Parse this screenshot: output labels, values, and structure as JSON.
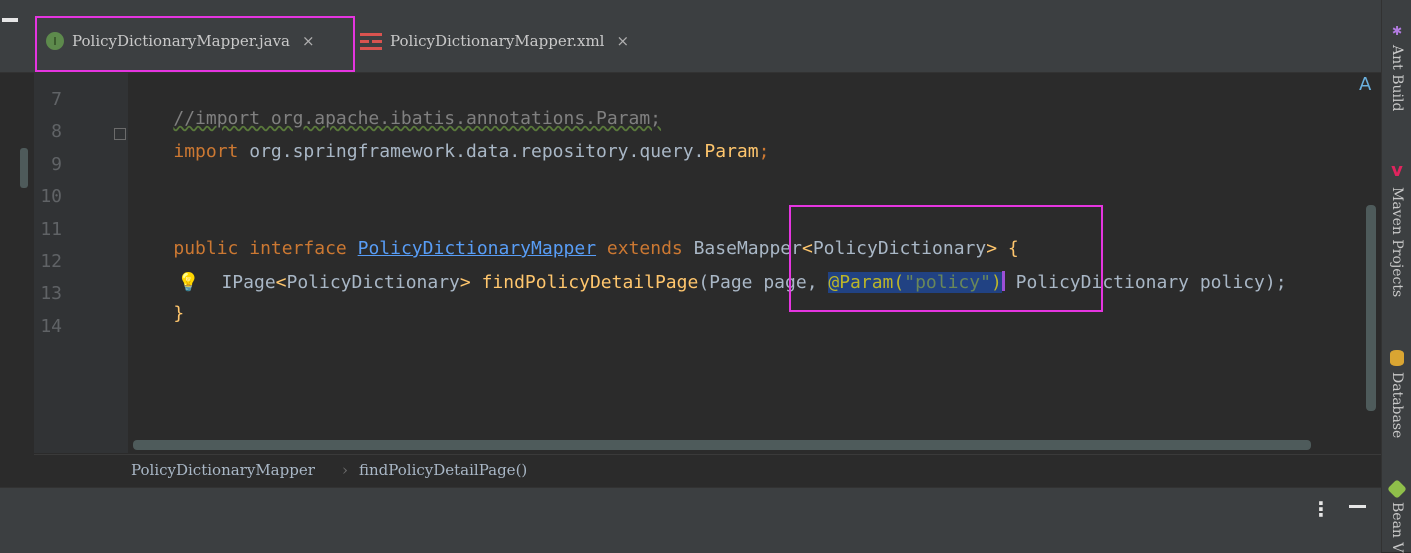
{
  "tabs": [
    {
      "label": "PolicyDictionaryMapper.java",
      "icon": "interface-icon",
      "icon_letter": "I",
      "close": "×",
      "active": true
    },
    {
      "label": "PolicyDictionaryMapper.xml",
      "icon": "xml-file-icon",
      "close": "×",
      "active": false
    }
  ],
  "editor": {
    "line_numbers": [
      "7",
      "8",
      "9",
      "10",
      "11",
      "12",
      "13",
      "14"
    ],
    "lines": {
      "l7": "//import org.apache.ibatis.annotations.Param;",
      "l8_kw": "import",
      "l8_pkg": " org.springframework.data.repository.query.",
      "l8_cls": "Param",
      "l8_end": ";",
      "l11_public": "public",
      "l11_interface": "interface",
      "l11_name": "PolicyDictionaryMapper",
      "l11_extends": "extends",
      "l11_base": "BaseMapper",
      "l11_lt": "<",
      "l11_type": "PolicyDictionary",
      "l11_gt": ">",
      "l11_brace": "{",
      "l12_ret": "IPage",
      "l12_lt": "<",
      "l12_type": "PolicyDictionary",
      "l12_gt": ">",
      "l12_method": "findPolicyDetailPage",
      "l12_params1": "(Page page, ",
      "l12_ann": "@Param(",
      "l12_str": "\"policy\"",
      "l12_annclose": ")",
      "l12_params2": " PolicyDictionary policy);",
      "l13": "}"
    }
  },
  "breadcrumb": {
    "interface": "PolicyDictionaryMapper",
    "separator": "›",
    "method": "findPolicyDetailPage()"
  },
  "right_sidebar": [
    {
      "label": "Ant Build",
      "icon": "ant-icon"
    },
    {
      "label": "Maven Projects",
      "icon": "maven-icon"
    },
    {
      "label": "Database",
      "icon": "database-icon"
    },
    {
      "label": "Bean V",
      "icon": "bean-icon"
    }
  ],
  "colors": {
    "annotation_box": "#e535e0",
    "keyword": "#cc7832",
    "string": "#6a8759",
    "method": "#ffc66d"
  }
}
